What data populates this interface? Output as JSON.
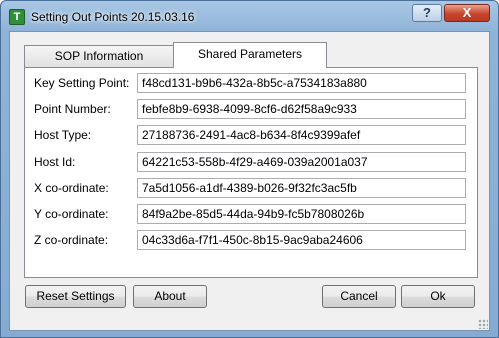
{
  "window": {
    "title": "Setting Out Points 20.15.03.16"
  },
  "titlebar": {
    "help_label": "?",
    "close_label": "X"
  },
  "tabs": [
    {
      "label": "SOP Information",
      "active": false
    },
    {
      "label": "Shared Parameters",
      "active": true
    }
  ],
  "fields": [
    {
      "label": "Key Setting Point:",
      "value": "f48cd131-b9b6-432a-8b5c-a7534183a880"
    },
    {
      "label": "Point Number:",
      "value": "febfe8b9-6938-4099-8cf6-d62f58a9c933"
    },
    {
      "label": "Host Type:",
      "value": "27188736-2491-4ac8-b634-8f4c9399afef"
    },
    {
      "label": "Host Id:",
      "value": "64221c53-558b-4f29-a469-039a2001a037"
    },
    {
      "label": "X co-ordinate:",
      "value": "7a5d1056-a1df-4389-b026-9f32fc3ac5fb"
    },
    {
      "label": "Y co-ordinate:",
      "value": "84f9a2be-85d5-44da-94b9-fc5b7808026b"
    },
    {
      "label": "Z co-ordinate:",
      "value": "04c33d6a-f7f1-450c-8b15-9ac9aba24606"
    }
  ],
  "buttons": {
    "reset": "Reset Settings",
    "about": "About",
    "cancel": "Cancel",
    "ok": "Ok"
  }
}
